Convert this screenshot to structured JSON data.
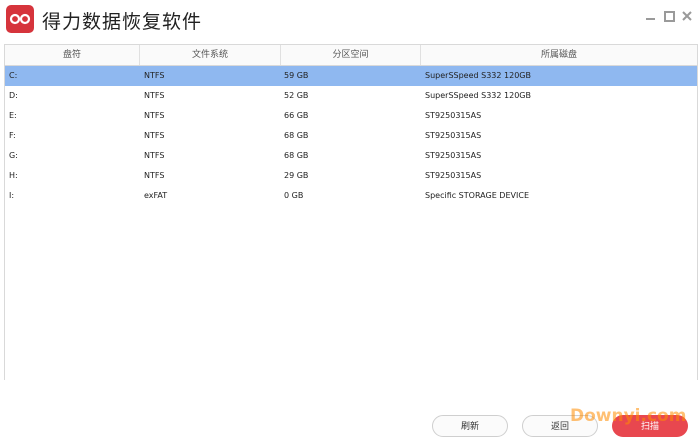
{
  "app": {
    "title": "得力数据恢复软件"
  },
  "table": {
    "headers": [
      "盘符",
      "文件系统",
      "分区空间",
      "所属磁盘"
    ],
    "rows": [
      {
        "drive": "C:",
        "fs": "NTFS",
        "size": "59 GB",
        "disk": "SuperSSpeed S332 120GB"
      },
      {
        "drive": "D:",
        "fs": "NTFS",
        "size": "52 GB",
        "disk": "SuperSSpeed S332 120GB"
      },
      {
        "drive": "E:",
        "fs": "NTFS",
        "size": "66 GB",
        "disk": "ST9250315AS"
      },
      {
        "drive": "F:",
        "fs": "NTFS",
        "size": "68 GB",
        "disk": "ST9250315AS"
      },
      {
        "drive": "G:",
        "fs": "NTFS",
        "size": "68 GB",
        "disk": "ST9250315AS"
      },
      {
        "drive": "H:",
        "fs": "NTFS",
        "size": "29 GB",
        "disk": "ST9250315AS"
      },
      {
        "drive": "I:",
        "fs": "exFAT",
        "size": "0 GB",
        "disk": "Specific STORAGE DEVICE"
      }
    ],
    "selected_row": 0
  },
  "footer": {
    "refresh_label": "刷新",
    "back_label": "返回",
    "scan_label": "扫描"
  },
  "watermark": "Downyi.com",
  "colors": {
    "accent": "#e8474f",
    "logo": "#d6343c",
    "selected_row": "#8fb8f0"
  }
}
